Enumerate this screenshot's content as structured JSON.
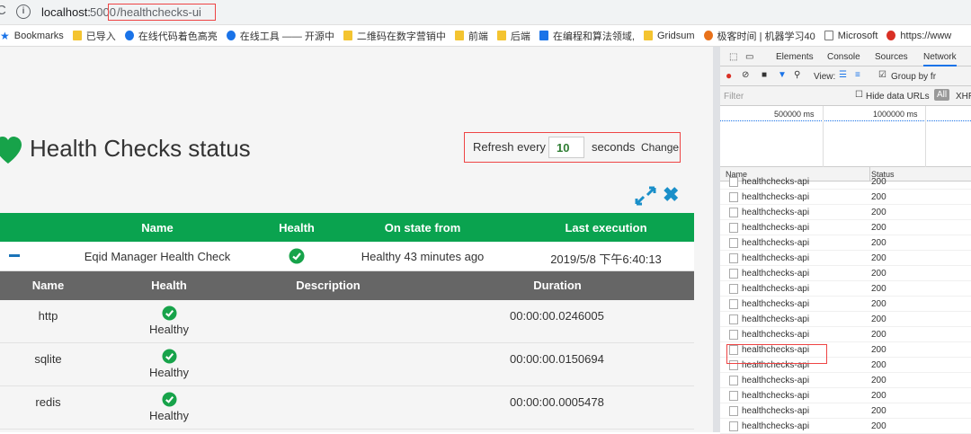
{
  "browser": {
    "url_host": "localhost:",
    "url_port": "5000",
    "url_path": "/healthchecks-ui",
    "bookmarks": [
      "Bookmarks",
      "已导入",
      "在线代码着色高亮",
      "在线工具 —— 开源中",
      "二维码在数字营销中",
      "前端",
      "后端",
      "在编程和算法领域,",
      "Gridsum",
      "极客时间 | 机器学习40",
      "Microsoft",
      "https://www"
    ]
  },
  "page": {
    "title": "Health Checks status",
    "refresh_label": "Refresh every",
    "refresh_value": "10",
    "seconds_label": "seconds",
    "change_label": "Change",
    "columns": [
      "Name",
      "Health",
      "On state from",
      "Last execution"
    ],
    "check": {
      "name": "Eqid Manager Health Check",
      "state_from": "Healthy 43 minutes ago",
      "last_execution": "2019/5/8 下午6:40:13"
    },
    "sub_columns": [
      "Name",
      "Health",
      "Description",
      "Duration"
    ],
    "entries": [
      {
        "name": "http",
        "health": "Healthy",
        "duration": "00:00:00.0246005"
      },
      {
        "name": "sqlite",
        "health": "Healthy",
        "duration": "00:00:00.0150694"
      },
      {
        "name": "redis",
        "health": "Healthy",
        "duration": "00:00:00.0005478"
      }
    ],
    "colors": {
      "green": "#0aa34f",
      "check_green": "#17a34a",
      "blue": "#1a8fc9"
    }
  },
  "devtools": {
    "tabs": [
      "Elements",
      "Console",
      "Sources",
      "Network"
    ],
    "view_label": "View:",
    "group_label": "Group by fr",
    "filter_placeholder": "Filter",
    "hide_label": "Hide data URLs",
    "all_label": "All",
    "xhr_label": "XHR",
    "time1": "500000 ms",
    "time2": "1000000 ms",
    "col_name": "Name",
    "col_status": "Status",
    "row_name": "healthchecks-api",
    "row_status": "200"
  }
}
